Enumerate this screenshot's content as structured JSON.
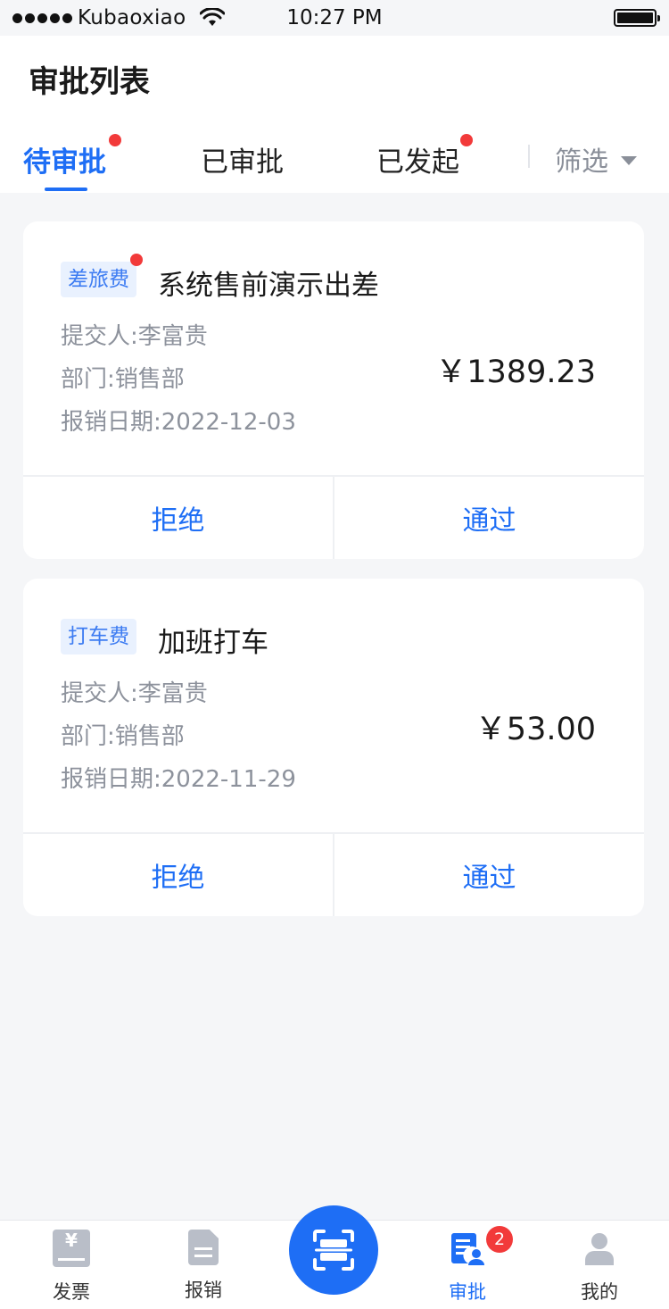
{
  "status_bar": {
    "carrier": "Kubaoxiao",
    "time": "10:27 PM"
  },
  "header": {
    "title": "审批列表",
    "tabs": [
      {
        "label": "待审批",
        "active": true,
        "has_dot": true
      },
      {
        "label": "已审批",
        "active": false,
        "has_dot": false
      },
      {
        "label": "已发起",
        "active": false,
        "has_dot": true
      }
    ],
    "filter_label": "筛选"
  },
  "cards": [
    {
      "tag": "差旅费",
      "has_dot": true,
      "title": "系统售前演示出差",
      "submitter": "提交人:李富贵",
      "department": "部门:销售部",
      "date": "报销日期:2022-12-03",
      "amount": "￥1389.23",
      "reject_label": "拒绝",
      "approve_label": "通过"
    },
    {
      "tag": "打车费",
      "has_dot": false,
      "title": "加班打车",
      "submitter": "提交人:李富贵",
      "department": "部门:销售部",
      "date": "报销日期:2022-11-29",
      "amount": "￥53.00",
      "reject_label": "拒绝",
      "approve_label": "通过"
    }
  ],
  "bottom_nav": {
    "items": [
      {
        "label": "发票",
        "icon": "invoice-icon"
      },
      {
        "label": "报销",
        "icon": "document-icon"
      },
      {
        "label": "",
        "icon": "scan-icon"
      },
      {
        "label": "审批",
        "icon": "approval-icon",
        "active": true,
        "badge": "2"
      },
      {
        "label": "我的",
        "icon": "person-icon"
      }
    ]
  },
  "colors": {
    "accent": "#1e6ef5",
    "dot": "#f23a3a",
    "tag_bg": "#e9f1fe",
    "muted_text": "#8d929c",
    "page_bg": "#f5f6f8"
  }
}
